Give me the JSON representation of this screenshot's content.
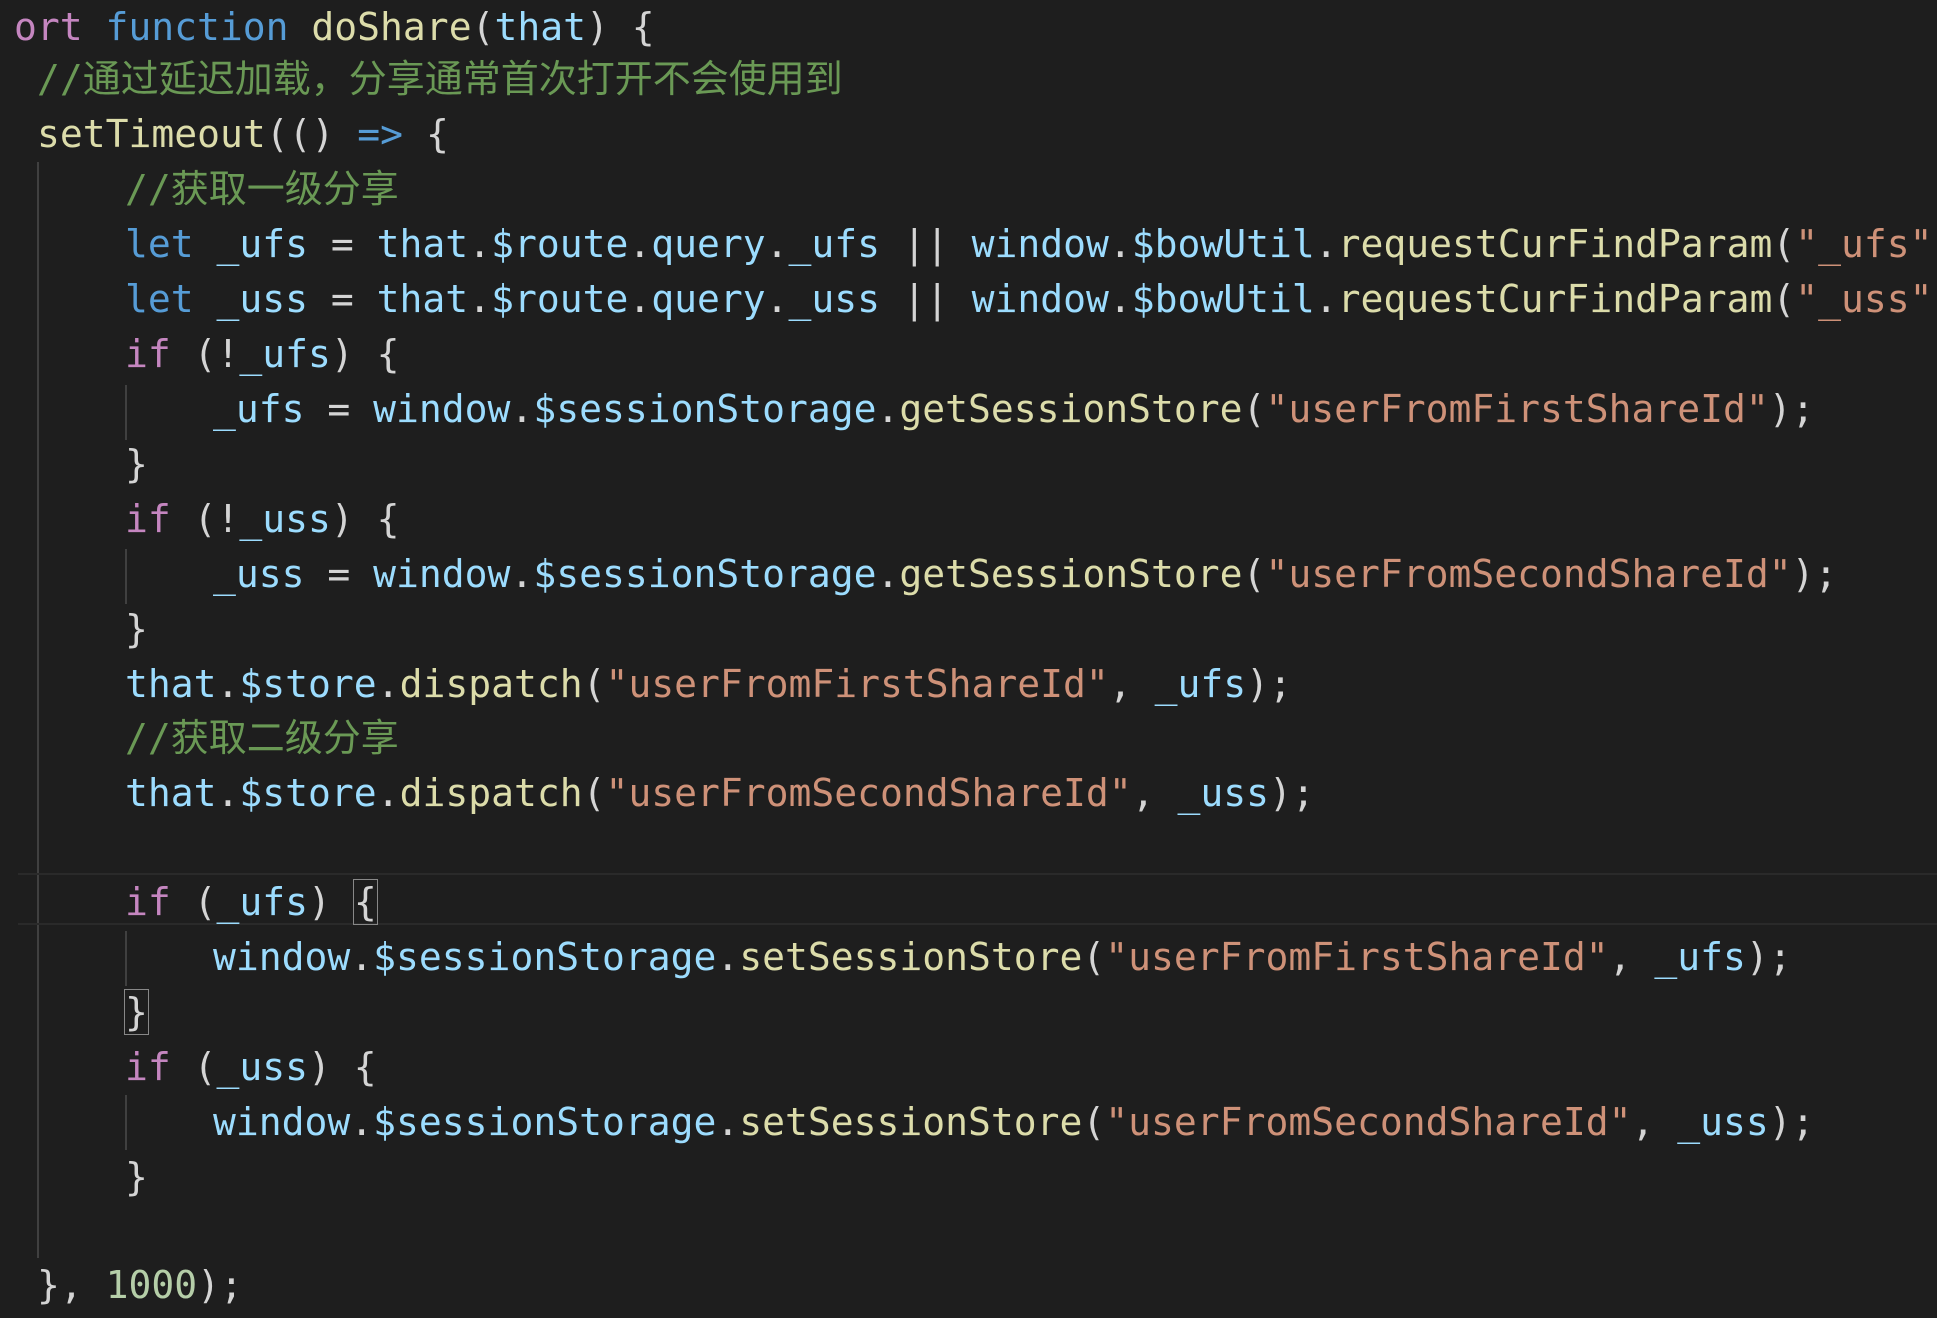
{
  "colors": {
    "background": "#1e1e1e",
    "keyword": "#569cd6",
    "control": "#c586c0",
    "function": "#dcdcaa",
    "variable": "#9cdcfe",
    "string": "#ce9178",
    "number": "#b5cea8",
    "comment": "#6a9955",
    "punctuation": "#d4d4d4"
  },
  "code": {
    "line1": {
      "a": "ort ",
      "b": "function ",
      "c": "doShare",
      "d": "(",
      "e": "that",
      "f": ") {"
    },
    "line2": {
      "a": "//通过延迟加载，分享通常首次打开不会使用到"
    },
    "line3": {
      "a": "setTimeout",
      "b": "(() ",
      "c": "=>",
      "d": " {"
    },
    "line4": {
      "a": "//获取一级分享"
    },
    "line5": {
      "a": "let ",
      "b": "_ufs",
      "c": " = ",
      "d": "that",
      "e": ".",
      "f": "$route",
      "g": ".",
      "h": "query",
      "i": ".",
      "j": "_ufs",
      "k": " || ",
      "l": "window",
      "m": ".",
      "n": "$bowUtil",
      "o": ".",
      "p": "requestCurFindParam",
      "q": "(",
      "r": "\"_ufs\"",
      "s": ");"
    },
    "line6": {
      "a": "let ",
      "b": "_uss",
      "c": " = ",
      "d": "that",
      "e": ".",
      "f": "$route",
      "g": ".",
      "h": "query",
      "i": ".",
      "j": "_uss",
      "k": " || ",
      "l": "window",
      "m": ".",
      "n": "$bowUtil",
      "o": ".",
      "p": "requestCurFindParam",
      "q": "(",
      "r": "\"_uss\"",
      "s": ");"
    },
    "line7": {
      "a": "if",
      "b": " (!",
      "c": "_ufs",
      "d": ") {"
    },
    "line8": {
      "a": "_ufs",
      "b": " = ",
      "c": "window",
      "d": ".",
      "e": "$sessionStorage",
      "f": ".",
      "g": "getSessionStore",
      "h": "(",
      "i": "\"userFromFirstShareId\"",
      "j": ");"
    },
    "line9": {
      "a": "}"
    },
    "line10": {
      "a": "if",
      "b": " (!",
      "c": "_uss",
      "d": ") {"
    },
    "line11": {
      "a": "_uss",
      "b": " = ",
      "c": "window",
      "d": ".",
      "e": "$sessionStorage",
      "f": ".",
      "g": "getSessionStore",
      "h": "(",
      "i": "\"userFromSecondShareId\"",
      "j": ");"
    },
    "line12": {
      "a": "}"
    },
    "line13": {
      "a": "that",
      "b": ".",
      "c": "$store",
      "d": ".",
      "e": "dispatch",
      "f": "(",
      "g": "\"userFromFirstShareId\"",
      "h": ", ",
      "i": "_ufs",
      "j": ");"
    },
    "line14": {
      "a": "//获取二级分享"
    },
    "line15": {
      "a": "that",
      "b": ".",
      "c": "$store",
      "d": ".",
      "e": "dispatch",
      "f": "(",
      "g": "\"userFromSecondShareId\"",
      "h": ", ",
      "i": "_uss",
      "j": ");"
    },
    "line17": {
      "a": "if",
      "b": " (",
      "c": "_ufs",
      "d": ") ",
      "e": "{"
    },
    "line18": {
      "a": "window",
      "b": ".",
      "c": "$sessionStorage",
      "d": ".",
      "e": "setSessionStore",
      "f": "(",
      "g": "\"userFromFirstShareId\"",
      "h": ", ",
      "i": "_ufs",
      "j": ");"
    },
    "line19": {
      "a": "}"
    },
    "line20": {
      "a": "if",
      "b": " (",
      "c": "_uss",
      "d": ") {"
    },
    "line21": {
      "a": "window",
      "b": ".",
      "c": "$sessionStorage",
      "d": ".",
      "e": "setSessionStore",
      "f": "(",
      "g": "\"userFromSecondShareId\"",
      "h": ", ",
      "i": "_uss",
      "j": ");"
    },
    "line22": {
      "a": "}"
    },
    "line24": {
      "a": "}, ",
      "b": "1000",
      "c": ");"
    }
  }
}
